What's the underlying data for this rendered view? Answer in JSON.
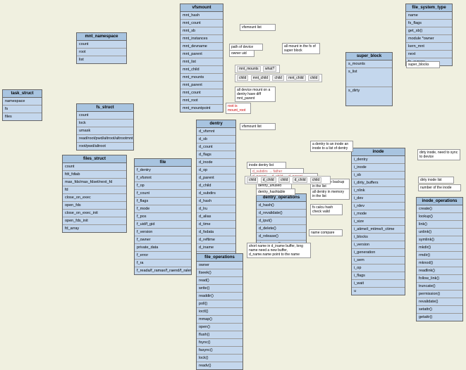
{
  "task_struct": {
    "title": "task_struct",
    "rows": [
      "namespace",
      "fs",
      "files"
    ]
  },
  "mnt_namespace": {
    "title": "mnt_namespace",
    "rows": [
      "count",
      "root",
      "list"
    ]
  },
  "fs_struct": {
    "title": "fs_struct",
    "rows": [
      "count",
      "lock",
      "umask",
      "read/root/pwd/altroot/altrootmnt",
      "root/pwd/altroot"
    ]
  },
  "files_struct": {
    "title": "files_struct",
    "rows": [
      "count",
      "fdt_fdtab",
      "max_fds/max_fdset/next_fd",
      "fd",
      "close_on_exec",
      "open_fds",
      "close_on_exec_init",
      "open_fds_init",
      "fd_array"
    ]
  },
  "file": {
    "title": "file",
    "rows": [
      "f_dentry",
      "f_vfsmnt",
      "f_op",
      "f_count",
      "f_flags",
      "f_mode",
      "f_pos",
      "f_uid/f_gid",
      "f_version",
      "f_owner",
      "private_data",
      "f_error",
      "f_ra",
      "f_reada/f_ramax/f_raend/f_ralen/f_rawin"
    ]
  },
  "vfsmount": {
    "title": "vfsmount",
    "rows": [
      "mnt_hash",
      "mnt_count",
      "mnt_sb",
      "mnt_instances",
      "mnt_devname",
      "mnt_parent",
      "mnt_list",
      "mnt_child",
      "mnt_mounts",
      "mnt_parent",
      "mnt_count",
      "mnt_root",
      "mnt_mountpoint"
    ]
  },
  "dentry": {
    "title": "dentry",
    "rows": [
      "d_vfsmnt",
      "d_sb",
      "d_count",
      "d_flags",
      "d_inode",
      "d_op",
      "d_parent",
      "d_child",
      "d_subdirs",
      "d_hash",
      "d_lru",
      "d_alias",
      "d_time",
      "d_fsdata",
      "d_reftime",
      "d_iname",
      "d_name"
    ]
  },
  "dentry_operations": {
    "title": "dentry_operations",
    "rows": [
      "d_hash()",
      "d_revalidate()",
      "d_iput()",
      "d_delete()",
      "d_release()",
      "d_compare()"
    ]
  },
  "file_operations": {
    "title": "file_operations",
    "rows": [
      "owner",
      "llseek()",
      "read()",
      "write()",
      "readdir()",
      "poll()",
      "ioctl()",
      "mmap()",
      "open()",
      "flush()",
      "fsync()",
      "fasync()",
      "lock()",
      "readv()"
    ]
  },
  "super_block": {
    "title": "super_block",
    "rows": [
      "s_mounts",
      "s_list",
      "s_dirty"
    ]
  },
  "file_system_type": {
    "title": "file_system_type",
    "rows": [
      "name",
      "fs_flags",
      "get_sb()",
      "module *owner",
      "kern_mnt",
      "next",
      "fs_supers"
    ]
  },
  "inode": {
    "title": "inode",
    "rows": [
      "i_dentry",
      "i_inode",
      "i_sb",
      "i_dirty_buffers",
      "i_nlink",
      "i_dev",
      "i_rdev",
      "i_mode",
      "i_size",
      "i_atime/i_mtime/i_ctime",
      "i_blocks",
      "i_version",
      "i_generation",
      "i_sem",
      "i_op",
      "i_flags",
      "i_wait",
      "u"
    ]
  },
  "inode_operations": {
    "title": "inode_operations",
    "rows": [
      "create()",
      "lookup()",
      "link()",
      "unlink()",
      "symlink()",
      "mkdir()",
      "rmdir()",
      "mknod()",
      "readlink()",
      "follow_link()",
      "truncate()",
      "permission()",
      "revalidate()",
      "setattr()",
      "getattr()"
    ]
  },
  "notes": {
    "vfsmount_list1": "vfsmount list",
    "vfsmount_list2": "vfsmount list",
    "path_device": "path of device",
    "owner_uid": "owner uid",
    "all_mount_sb": "all mount in the fs of super block",
    "all_device_mount": "all device mount on a dentry have diff mnt_parent",
    "root_mount": "root is mount_root",
    "inode_dentry_list": "inode dentry list",
    "a_dentry_inode": "a dentry to an inode an inode to a list of dentry",
    "dentry_unused": "dentry_unused",
    "dentry_hashtable": "dentry_hashtable",
    "dentry_0use": "dentry 0-use backup in the list",
    "all_dentry_mem": "all dentry in memory in the list",
    "fs_calcu_hash": "fs calcu hash check valid",
    "name_compare": "name compare",
    "short_name": "short name in d_iname buffer, long name need a new buffer, d_name.name point to the name",
    "super_blocks": "super_blocks",
    "dirty_inode": "dirty inode, need to sync to device",
    "dirty_inode_list": "dirty inode list",
    "number_inode": "number of the inode",
    "d_subdirs_father": "d_subdirs → father",
    "d_parent_child": "d_parent ← d_child ← d_parent"
  },
  "mnt_mounts_chain": [
    "mnt_mounts",
    "what?"
  ],
  "child_chain": [
    "child",
    "mnt_child",
    "child",
    "mnt_child",
    "child"
  ],
  "dentry_child_chain": [
    "child",
    "d_child",
    "child",
    "d_child",
    "child"
  ]
}
